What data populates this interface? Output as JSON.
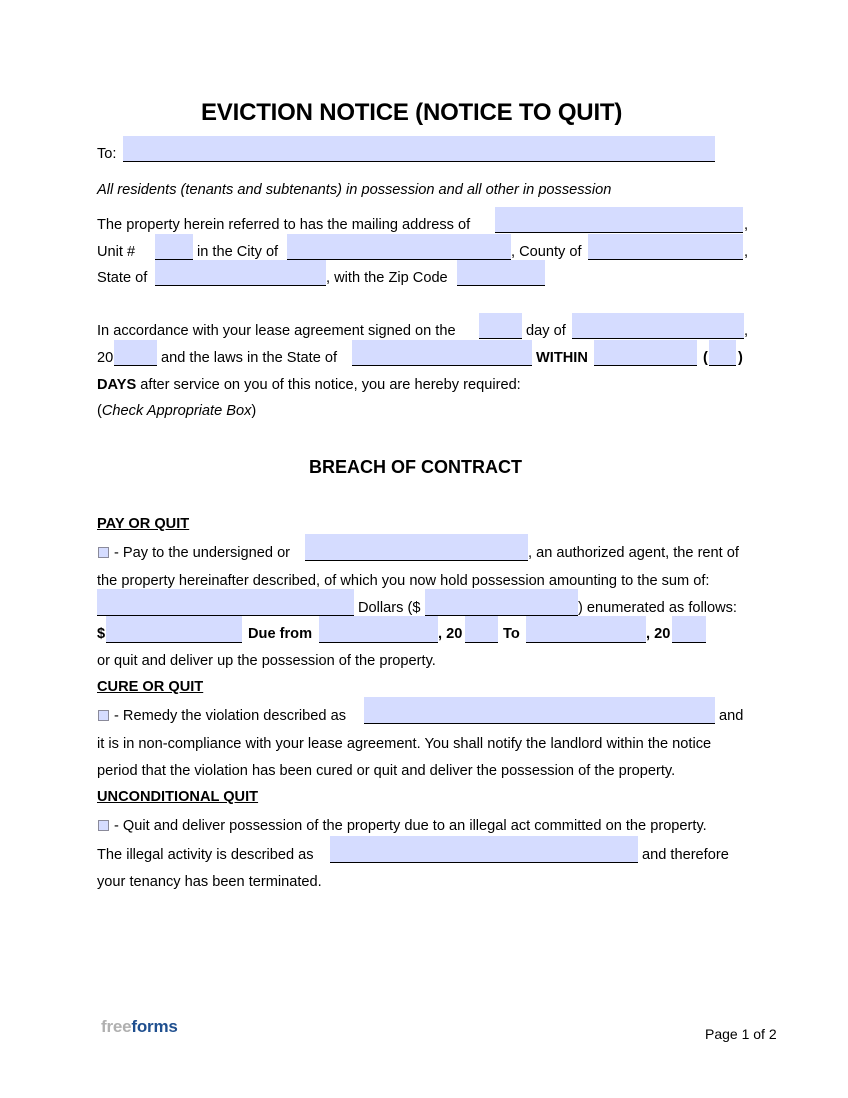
{
  "document": {
    "title": "EVICTION NOTICE (NOTICE TO QUIT)",
    "to_label": "To:",
    "residents_line": "All residents (tenants and subtenants) in possession and all other in possession",
    "address": {
      "line1": "The property herein referred to has the mailing address of",
      "comma": ",",
      "unit_label": "Unit #",
      "city_label": "in the City of",
      "county_label": ", County of",
      "state_label": "State of",
      "zip_label": ", with the Zip Code"
    },
    "lease": {
      "line1_a": "In accordance with your lease agreement signed on the",
      "line1_b": "day of",
      "comma": ",",
      "year_prefix": "20",
      "laws_label": "and the laws in the State of",
      "within_label": "WITHIN",
      "paren_open": "(",
      "paren_close": ")",
      "days_bold": "DAYS",
      "days_rest": "after service on you of this notice, you are hereby required:",
      "check_open": "(",
      "check_italic": "Check Appropriate Box",
      "check_close": ")"
    },
    "breach_heading": "BREACH OF CONTRACT",
    "pay_or_quit": {
      "heading": "PAY OR QUIT",
      "line1_a": "- Pay to the undersigned or",
      "line1_b": ", an authorized agent, the rent of",
      "line2": "the property hereinafter described, of which you now hold possession amounting to the sum of:",
      "dollars_label": "Dollars ($",
      "enumerated_label": ") enumerated as follows:",
      "dollar_sign": "$",
      "due_from_label": "Due from",
      "comma_20_a": ", 20",
      "to_label": "To",
      "comma_20_b": ", 20",
      "line5": "or quit and deliver up the possession of the property."
    },
    "cure_or_quit": {
      "heading": "CURE OR QUIT",
      "line1_a": "- Remedy the violation described as",
      "line1_b": "and",
      "line2": "it is in non-compliance with your lease agreement. You shall notify the landlord within the notice",
      "line3": "period that the violation has been cured or quit and deliver the possession of the property."
    },
    "unconditional_quit": {
      "heading": "UNCONDITIONAL QUIT",
      "line1": "- Quit and deliver possession of the property due to an illegal act committed on the property.",
      "line2_a": "The illegal activity is described as",
      "line2_b": "and therefore",
      "line3": "your tenancy has been terminated."
    },
    "fields": {
      "to": "",
      "mailing_address": "",
      "unit": "",
      "city": "",
      "county": "",
      "state": "",
      "zip": "",
      "lease_day": "",
      "lease_month": "",
      "lease_year": "",
      "laws_state": "",
      "within_days_words": "",
      "within_days_number": "",
      "agent_name": "",
      "amount_words": "",
      "amount_number": "",
      "enum_amount": "",
      "due_from_date": "",
      "due_from_year": "",
      "due_to_date": "",
      "due_to_year": "",
      "violation": "",
      "illegal_activity": ""
    },
    "checkboxes": {
      "pay_or_quit": false,
      "cure_or_quit": false,
      "unconditional_quit": false
    }
  },
  "footer": {
    "logo_free": "free",
    "logo_forms": "forms",
    "page_label": "Page 1 of 2"
  },
  "colors": {
    "field_highlight": "#d5dcff",
    "logo_gray": "#b0b0b0",
    "logo_blue": "#1f4f8f"
  }
}
